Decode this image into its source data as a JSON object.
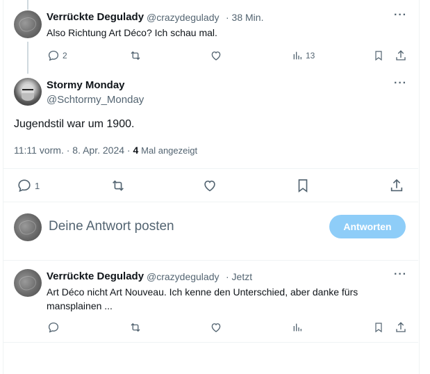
{
  "reply_top": {
    "author_name": "Verrückte Degulady",
    "author_handle": "@crazydegulady",
    "time": "· 38 Min.",
    "text": "Also Richtung Art Déco? Ich schau mal.",
    "reply_count": "2",
    "views_count": "13"
  },
  "main_post": {
    "author_name": "Stormy Monday",
    "author_handle": "@Schtormy_Monday",
    "text": "Jugendstil war um 1900.",
    "timestamp": "11:11 vorm. · 8. Apr. 2024 ·",
    "views_count": "4",
    "views_label": "Mal angezeigt",
    "reply_count": "1"
  },
  "composer": {
    "placeholder": "Deine Antwort posten",
    "submit_label": "Antworten"
  },
  "reply_bottom": {
    "author_name": "Verrückte Degulady",
    "author_handle": "@crazydegulady",
    "time": "· Jetzt",
    "text": "Art Déco nicht Art Nouveau. Ich kenne den Unterschied, aber danke fürs mansplainen ..."
  },
  "more_glyph": "···",
  "colors": {
    "accent_button": "#8ecdf8",
    "muted_text": "#536471",
    "divider": "#eff3f4"
  }
}
